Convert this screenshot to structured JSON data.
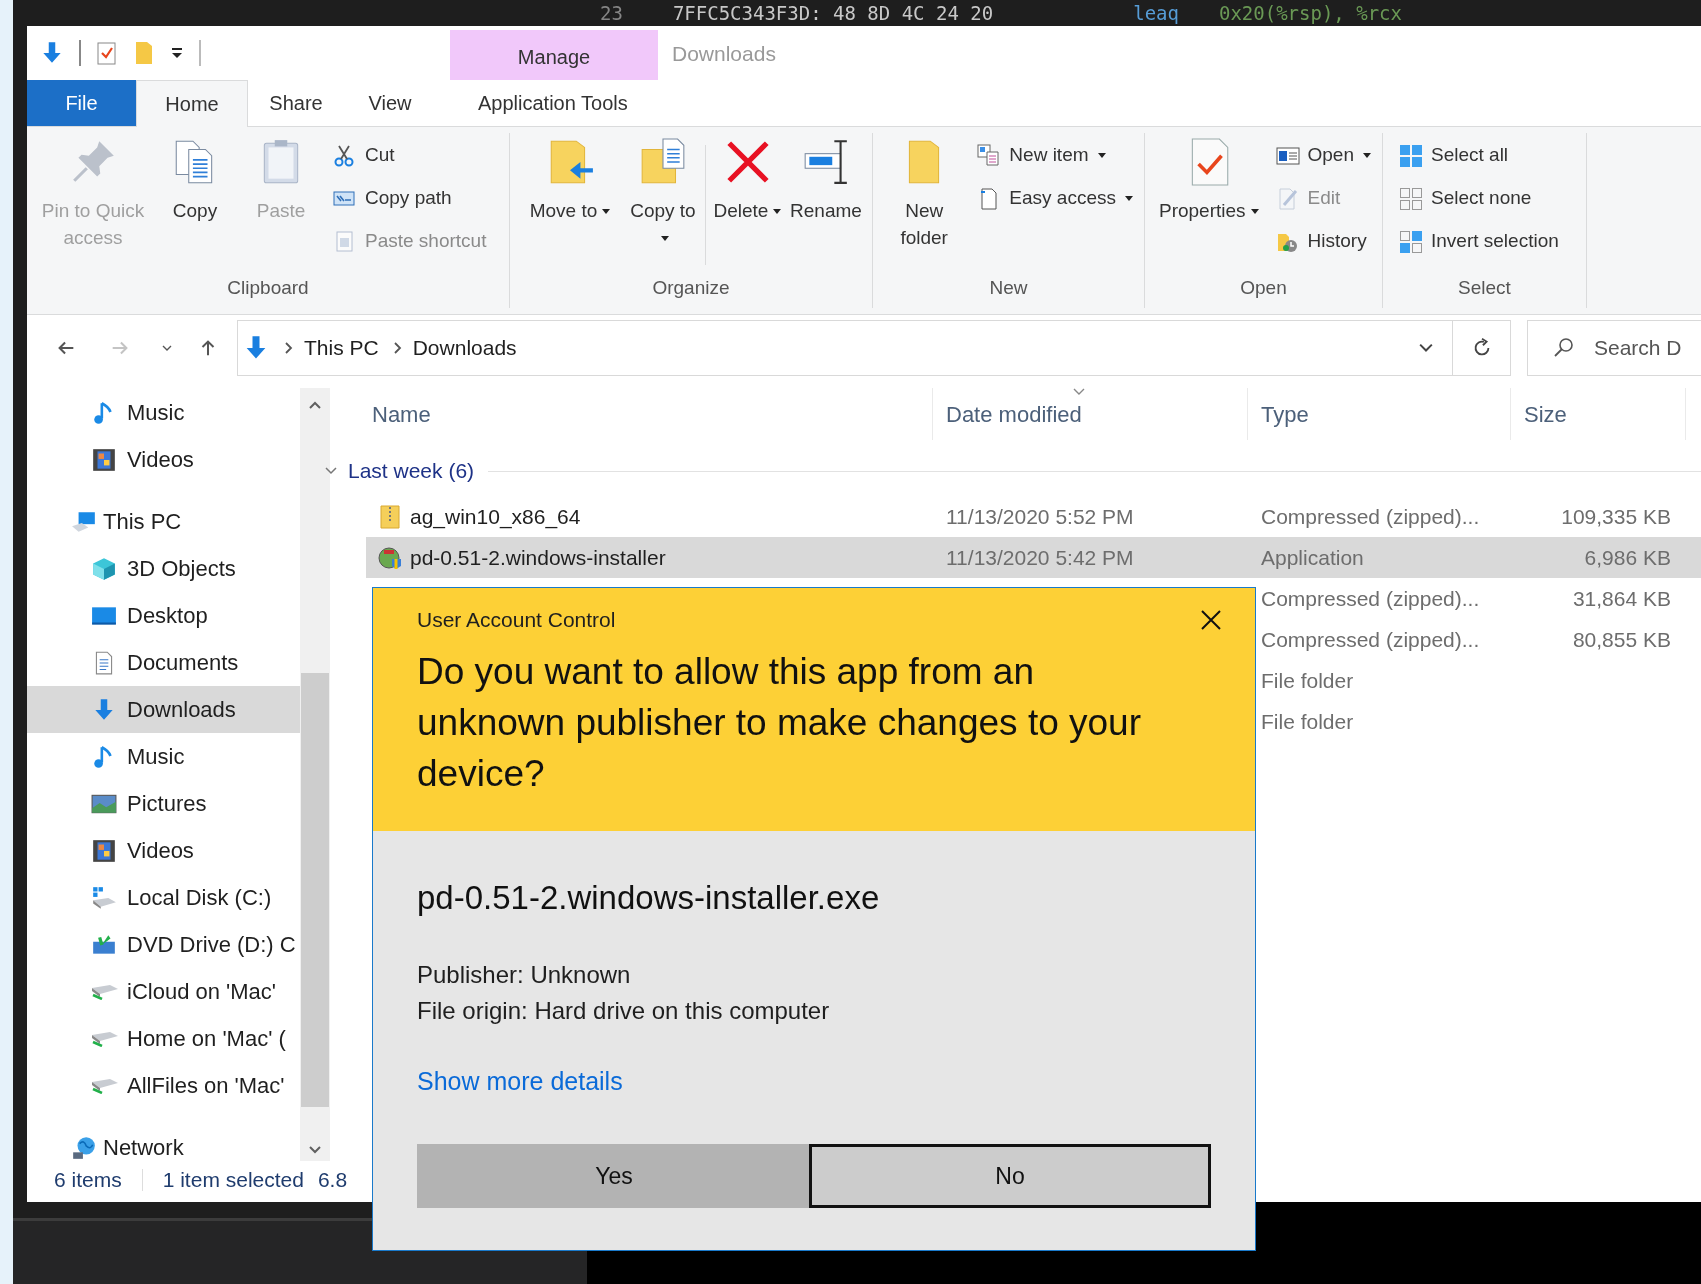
{
  "terminal": {
    "line_number": "23",
    "bytes": "7FFC5C343F3D: 48 8D 4C 24 20",
    "instruction": "leaq",
    "operands": "0x20(%rsp), %rcx"
  },
  "explorer": {
    "context_tab": "Manage",
    "title": "Downloads",
    "ribbon_tabs": [
      {
        "kind": "file",
        "label": "File",
        "selected": false
      },
      {
        "kind": "tab",
        "label": "Home",
        "selected": true
      },
      {
        "kind": "tab",
        "label": "Share",
        "selected": false
      },
      {
        "kind": "tab",
        "label": "View",
        "selected": false
      },
      {
        "kind": "tab",
        "label": "Application Tools",
        "selected": false
      }
    ],
    "ribbon_groups": [
      {
        "label": "Clipboard",
        "items": [
          {
            "kind": "large",
            "label": "Pin to Quick access",
            "disabled": true,
            "dropdown": false
          },
          {
            "kind": "large",
            "label": "Copy",
            "disabled": false,
            "dropdown": false
          },
          {
            "kind": "large",
            "label": "Paste",
            "disabled": true,
            "dropdown": false
          },
          {
            "kind": "stack",
            "items": [
              {
                "label": "Cut",
                "disabled": false,
                "dropdown": false
              },
              {
                "label": "Copy path",
                "disabled": false,
                "dropdown": false
              },
              {
                "label": "Paste shortcut",
                "disabled": true,
                "dropdown": false
              }
            ]
          }
        ]
      },
      {
        "label": "Organize",
        "items": [
          {
            "kind": "large",
            "label": "Move to",
            "disabled": false,
            "dropdown": true
          },
          {
            "kind": "large",
            "label": "Copy to",
            "disabled": false,
            "dropdown": true
          },
          {
            "kind": "separator"
          },
          {
            "kind": "large",
            "label": "Delete",
            "disabled": false,
            "dropdown": true
          },
          {
            "kind": "large",
            "label": "Rename",
            "disabled": false,
            "dropdown": false
          }
        ]
      },
      {
        "label": "New",
        "items": [
          {
            "kind": "large",
            "label": "New folder",
            "disabled": false,
            "dropdown": false
          },
          {
            "kind": "stack",
            "items": [
              {
                "label": "New item",
                "disabled": false,
                "dropdown": true
              },
              {
                "label": "Easy access",
                "disabled": false,
                "dropdown": true
              }
            ]
          }
        ]
      },
      {
        "label": "Open",
        "items": [
          {
            "kind": "large",
            "label": "Properties",
            "disabled": false,
            "dropdown": true
          },
          {
            "kind": "stack",
            "items": [
              {
                "label": "Open",
                "disabled": false,
                "dropdown": true
              },
              {
                "label": "Edit",
                "disabled": true,
                "dropdown": false
              },
              {
                "label": "History",
                "disabled": false,
                "dropdown": false
              }
            ]
          }
        ]
      },
      {
        "label": "Select",
        "items": [
          {
            "kind": "stack",
            "items": [
              {
                "label": "Select all",
                "disabled": false,
                "dropdown": false
              },
              {
                "label": "Select none",
                "disabled": false,
                "dropdown": false
              },
              {
                "label": "Invert selection",
                "disabled": false,
                "dropdown": false
              }
            ]
          }
        ]
      }
    ],
    "nav_buttons": [
      {
        "disabled": false
      },
      {
        "disabled": true
      },
      {
        "disabled": false
      },
      {
        "disabled": false
      }
    ],
    "breadcrumb": [
      "This PC",
      "Downloads"
    ],
    "search": {
      "placeholder": "Search D"
    },
    "sidebar": {
      "quick_access": [
        {
          "label": "Music",
          "selected": false
        },
        {
          "label": "Videos",
          "selected": false
        }
      ],
      "tree": [
        {
          "label": "This PC",
          "selected": false,
          "children": [
            {
              "label": "3D Objects",
              "selected": false
            },
            {
              "label": "Desktop",
              "selected": false
            },
            {
              "label": "Documents",
              "selected": false
            },
            {
              "label": "Downloads",
              "selected": true
            },
            {
              "label": "Music",
              "selected": false
            },
            {
              "label": "Pictures",
              "selected": false
            },
            {
              "label": "Videos",
              "selected": false
            },
            {
              "label": "Local Disk (C:)",
              "selected": false
            },
            {
              "label": "DVD Drive (D:) C",
              "selected": false
            },
            {
              "label": "iCloud on 'Mac'",
              "selected": false
            },
            {
              "label": "Home on 'Mac' (",
              "selected": false
            },
            {
              "label": "AllFiles on 'Mac'",
              "selected": false
            }
          ]
        },
        {
          "label": "Network",
          "selected": false
        }
      ]
    },
    "columns": [
      {
        "label": "Name",
        "sorted": false
      },
      {
        "label": "Date modified",
        "sorted": true
      },
      {
        "label": "Type",
        "sorted": false
      },
      {
        "label": "Size",
        "sorted": false
      }
    ],
    "group": {
      "label": "Last week (6)",
      "expanded": true
    },
    "files": [
      {
        "name": "ag_win10_x86_64",
        "date_modified": "11/13/2020 5:52 PM",
        "type": "Compressed (zipped)...",
        "size": "109,335 KB",
        "selected": false
      },
      {
        "name": "pd-0.51-2.windows-installer",
        "date_modified": "11/13/2020 5:42 PM",
        "type": "Application",
        "size": "6,986 KB",
        "selected": true
      },
      {
        "type": "Compressed (zipped)...",
        "size": "31,864 KB",
        "selected": false
      },
      {
        "type": "Compressed (zipped)...",
        "size": "80,855 KB",
        "selected": false
      },
      {
        "type": "File folder",
        "selected": false
      },
      {
        "type": "File folder",
        "selected": false
      }
    ],
    "status_bar": {
      "item_count": "6 items",
      "selection": "1 item selected",
      "selection_size": "6.8"
    }
  },
  "uac_dialog": {
    "title": "User Account Control",
    "question": "Do you want to allow this app from an unknown publisher to make changes to your device?",
    "file_name": "pd-0.51-2.windows-installer.exe",
    "publisher": "Publisher: Unknown",
    "file_origin": "File origin: Hard drive on this computer",
    "details_link": "Show more details",
    "buttons": [
      {
        "label": "Yes",
        "focused": false
      },
      {
        "label": "No",
        "focused": true
      }
    ]
  }
}
